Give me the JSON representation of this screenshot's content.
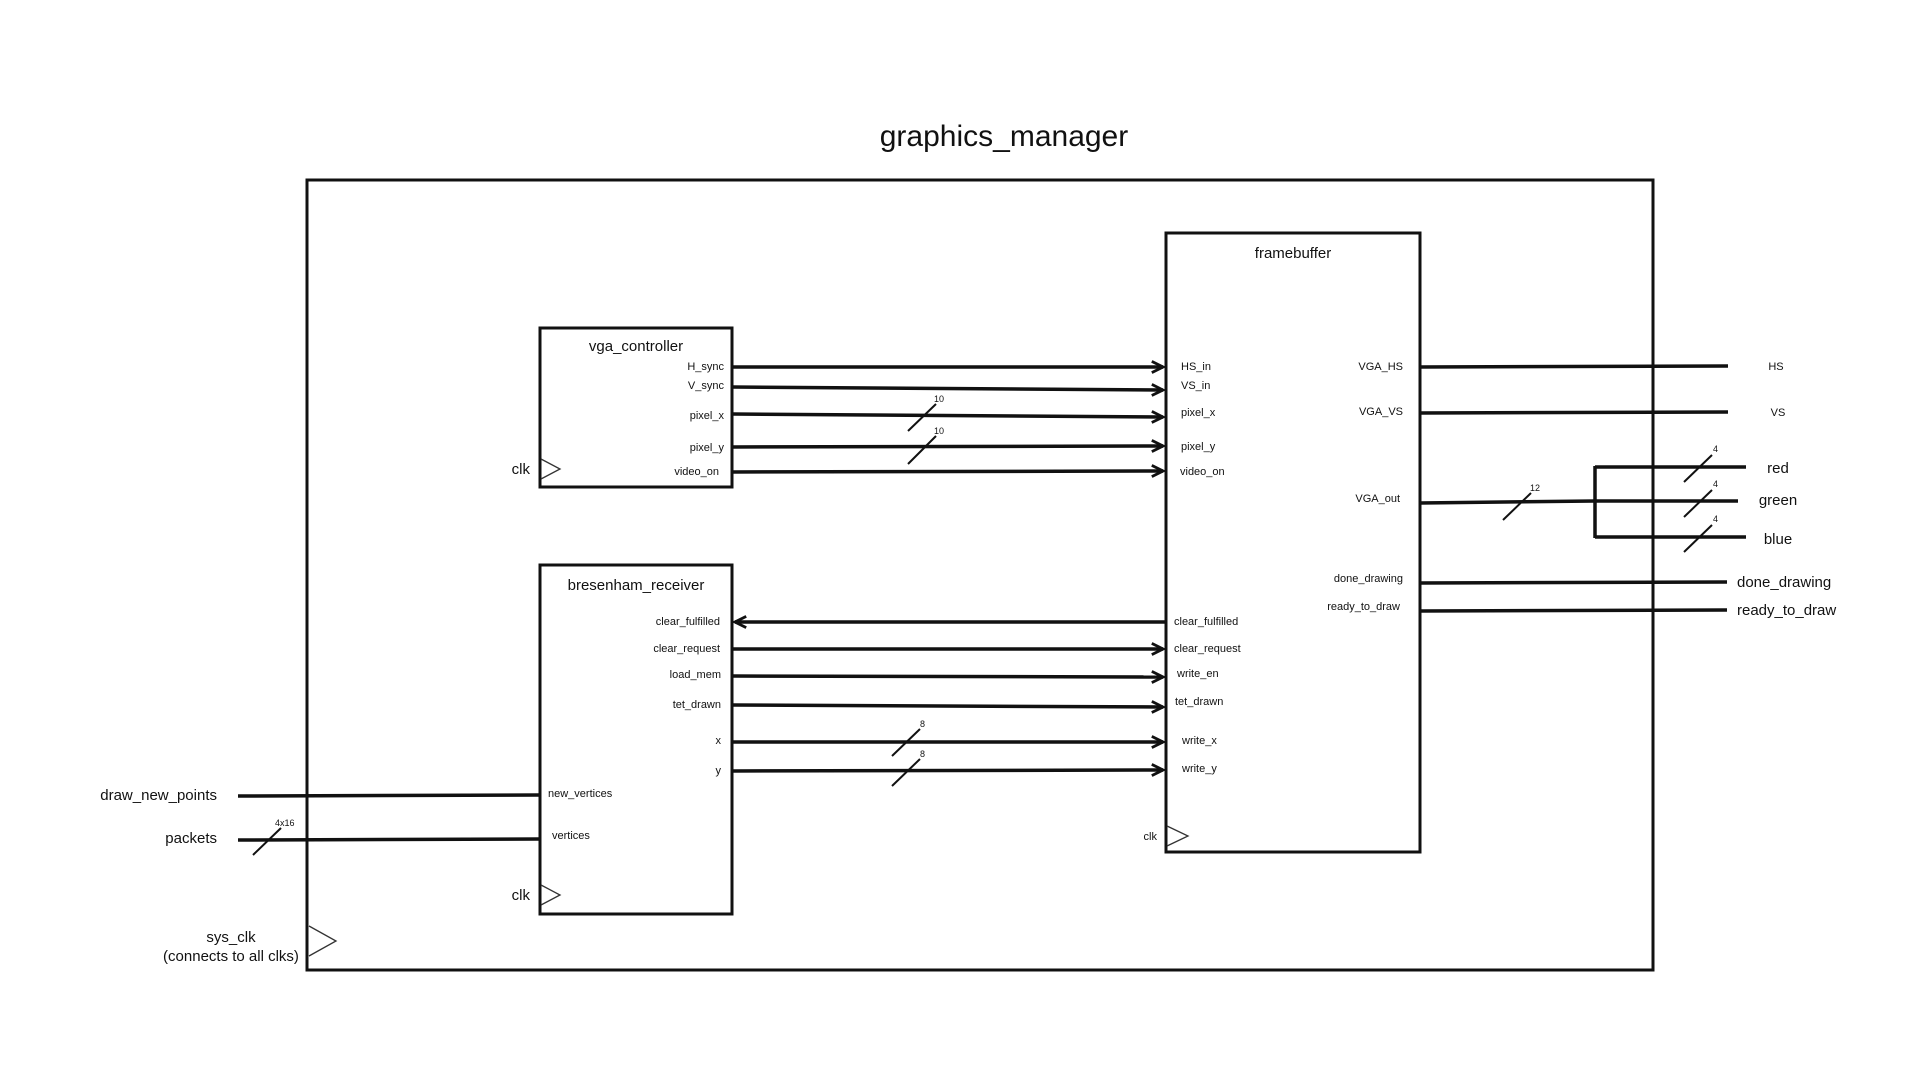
{
  "title": "graphics_manager",
  "modules": {
    "vga_controller": {
      "name": "vga_controller",
      "outputs": [
        "H_sync",
        "V_sync",
        "pixel_x",
        "pixel_y",
        "video_on"
      ],
      "clk": "clk"
    },
    "bresenham_receiver": {
      "name": "bresenham_receiver",
      "right_ports": [
        "clear_fulfilled",
        "clear_request",
        "load_mem",
        "tet_drawn",
        "x",
        "y"
      ],
      "left_ports": [
        "new_vertices",
        "vertices"
      ],
      "clk": "clk"
    },
    "framebuffer": {
      "name": "framebuffer",
      "left_ports": [
        "HS_in",
        "VS_in",
        "pixel_x",
        "pixel_y",
        "video_on",
        "clear_fulfilled",
        "clear_request",
        "write_en",
        "tet_drawn",
        "write_x",
        "write_y"
      ],
      "right_ports": [
        "VGA_HS",
        "VGA_VS",
        "VGA_out",
        "done_drawing",
        "ready_to_draw"
      ],
      "clk": "clk"
    }
  },
  "external": {
    "inputs": [
      "draw_new_points",
      "packets"
    ],
    "outputs": [
      "HS",
      "VS",
      "red",
      "green",
      "blue",
      "done_drawing",
      "ready_to_draw"
    ],
    "sys_clk": "sys_clk",
    "sys_clk_note": "(connects to all clks)"
  },
  "bus_widths": {
    "pixel_x": "10",
    "pixel_y": "10",
    "write_x": "8",
    "write_y": "8",
    "packets": "4x16",
    "vga_out": "12",
    "red": "4",
    "green": "4",
    "blue": "4"
  }
}
